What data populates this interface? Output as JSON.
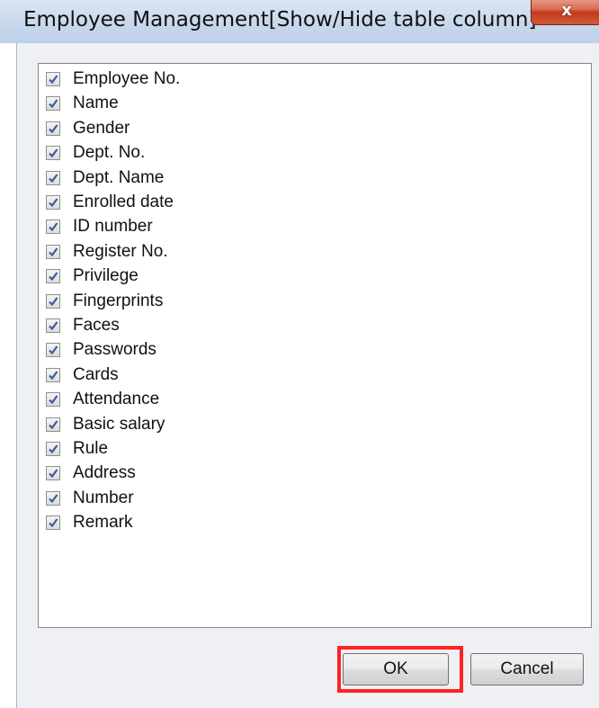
{
  "window": {
    "title": "Employee Management[Show/Hide table column]",
    "close_glyph": "x"
  },
  "columns": [
    {
      "label": "Employee No.",
      "checked": true
    },
    {
      "label": "Name",
      "checked": true
    },
    {
      "label": "Gender",
      "checked": true
    },
    {
      "label": "Dept. No.",
      "checked": true
    },
    {
      "label": "Dept. Name",
      "checked": true
    },
    {
      "label": "Enrolled date",
      "checked": true
    },
    {
      "label": "ID number",
      "checked": true
    },
    {
      "label": "Register No.",
      "checked": true
    },
    {
      "label": "Privilege",
      "checked": true
    },
    {
      "label": "Fingerprints",
      "checked": true
    },
    {
      "label": "Faces",
      "checked": true
    },
    {
      "label": "Passwords",
      "checked": true
    },
    {
      "label": "Cards",
      "checked": true
    },
    {
      "label": "Attendance",
      "checked": true
    },
    {
      "label": "Basic salary",
      "checked": true
    },
    {
      "label": "Rule",
      "checked": true
    },
    {
      "label": "Address",
      "checked": true
    },
    {
      "label": "Number",
      "checked": true
    },
    {
      "label": "Remark",
      "checked": true
    }
  ],
  "buttons": {
    "ok_label": "OK",
    "cancel_label": "Cancel"
  },
  "colors": {
    "highlight": "#ff2222",
    "check_mark": "#3a5a9a",
    "close_button": "#c2391d"
  },
  "icons": {
    "close": "close-icon",
    "checkbox": "checkmark-icon"
  }
}
